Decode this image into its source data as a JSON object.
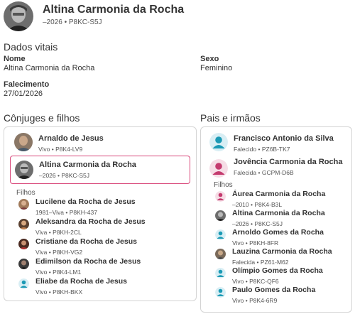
{
  "header": {
    "name": "Altina Carmonia da Rocha",
    "sub": "–2026 • P8KC-S5J"
  },
  "vitals": {
    "title": "Dados vitais",
    "name_label": "Nome",
    "name_value": "Altina Carmonia da Rocha",
    "sex_label": "Sexo",
    "sex_value": "Feminino",
    "death_label": "Falecimento",
    "death_value": "27/01/2026"
  },
  "spouses": {
    "title": "Cônjuges e filhos",
    "spouse": {
      "name": "Arnaldo de Jesus",
      "sub": "Vivo • P8K4-LV9"
    },
    "self": {
      "name": "Altina Carmonia da Rocha",
      "sub": "–2026 • P8KC-S5J"
    },
    "children_label": "Filhos",
    "children": [
      {
        "name": "Lucilene da Rocha de Jesus",
        "sub": "1981–Viva • P8KH-437"
      },
      {
        "name": "Aleksandra da Rocha de Jesus",
        "sub": "Viva • P8KH-2CL"
      },
      {
        "name": "Cristiane da Rocha de Jesus",
        "sub": "Viva • P8KH-VG2"
      },
      {
        "name": "Edimilson da Rocha de Jesus",
        "sub": "Vivo • P8K4-LM1"
      },
      {
        "name": "Eliabe da Rocha de Jesus",
        "sub": "Vivo • P8KH-BKX"
      }
    ]
  },
  "parents": {
    "title": "Pais e irmãos",
    "father": {
      "name": "Francisco Antonio da Silva",
      "sub": "Falecido • PZ6B-TK7"
    },
    "mother": {
      "name": "Jovência Carmonia da Rocha",
      "sub": "Falecida • GCPM-D6B"
    },
    "siblings_label": "Filhos",
    "siblings": [
      {
        "name": "Áurea Carmonia da Rocha",
        "sub": "–2010 • P8K4-B3L"
      },
      {
        "name": "Altina Carmonia da Rocha",
        "sub": "–2026 • P8KC-S5J"
      },
      {
        "name": "Arnoldo Gomes da Rocha",
        "sub": "Vivo • P8KH-8FR"
      },
      {
        "name": "Lauzina Carmonia da Rocha",
        "sub": "Falecida • PZ61-M62"
      },
      {
        "name": "Olímpio Gomes da Rocha",
        "sub": "Vivo • P8KC-QF6"
      },
      {
        "name": "Paulo Gomes da Rocha",
        "sub": "Vivo • P8K4-6R9"
      }
    ]
  },
  "colors": {
    "male_icon": "#1b9ab5",
    "female_icon": "#c43a6e",
    "selected_border": "#d9477a"
  }
}
